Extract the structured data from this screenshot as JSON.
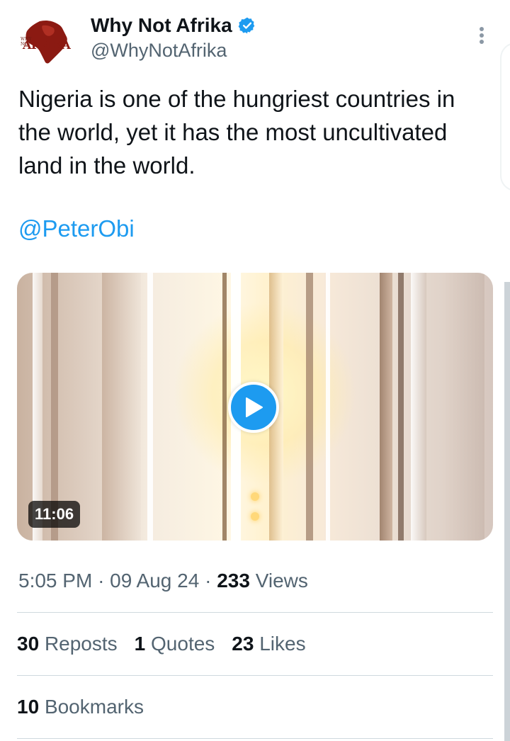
{
  "author": {
    "name": "Why Not Afrika",
    "handle": "@WhyNotAfrika",
    "verified": true,
    "avatar_text": "AFRIKA",
    "avatar_small_text": "WHY NOT"
  },
  "tweet": {
    "text": "Nigeria is one of the hungriest countries in the world, yet it has the most uncultivated land in the world.",
    "mention": "@PeterObi"
  },
  "media": {
    "type": "video",
    "duration": "11:06"
  },
  "meta": {
    "time": "5:05 PM",
    "date": "09 Aug 24",
    "views_count": "233",
    "views_label": "Views",
    "separator": "·"
  },
  "stats": {
    "reposts_count": "30",
    "reposts_label": "Reposts",
    "quotes_count": "1",
    "quotes_label": "Quotes",
    "likes_count": "23",
    "likes_label": "Likes",
    "bookmarks_count": "10",
    "bookmarks_label": "Bookmarks"
  },
  "colors": {
    "link": "#1d9bf0",
    "verified_badge": "#1d9bf0",
    "secondary_text": "#536471",
    "primary_text": "#0f1419"
  },
  "icons": {
    "verified": "verified-badge-icon",
    "more": "more-vertical-icon",
    "play": "play-icon"
  }
}
